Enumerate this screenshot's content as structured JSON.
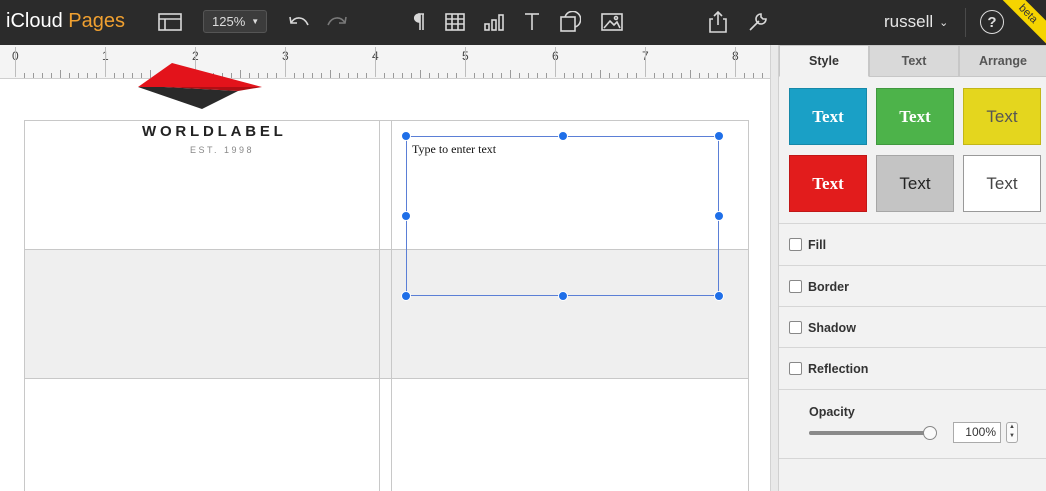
{
  "app": {
    "brand_prefix": "iCloud",
    "brand_app": "Pages"
  },
  "toolbar": {
    "zoom_value": "125%",
    "user_name": "russell",
    "help_glyph": "?",
    "beta_label": "beta",
    "icons": [
      "sidebar-view-icon",
      "undo-icon",
      "redo-icon",
      "paragraph-icon",
      "table-icon",
      "chart-icon",
      "text-icon",
      "shape-icon",
      "media-icon",
      "share-icon",
      "wrench-icon"
    ]
  },
  "ruler": {
    "labels": [
      "0",
      "1",
      "2",
      "3",
      "4",
      "5",
      "6",
      "7",
      "8"
    ]
  },
  "document": {
    "logo_word": "WORLDLABEL",
    "logo_est": "EST. 1998",
    "textbox_text": "Type to enter text"
  },
  "panel": {
    "tabs": [
      "Style",
      "Text",
      "Arrange"
    ],
    "active_tab": "Style",
    "styles": [
      {
        "label": "Text",
        "bg": "#1aa0c6",
        "fg": "#ffffff",
        "font": "serif"
      },
      {
        "label": "Text",
        "bg": "#4db34a",
        "fg": "#ffffff",
        "font": "serif"
      },
      {
        "label": "Text",
        "bg": "#e4d61e",
        "fg": "#555555",
        "font": "sans"
      },
      {
        "label": "Text",
        "bg": "#e21c1c",
        "fg": "#ffffff",
        "font": "serif"
      },
      {
        "label": "Text",
        "bg": "#c4c4c4",
        "fg": "#222222",
        "font": "sans"
      },
      {
        "label": "Text",
        "bg": "#ffffff",
        "fg": "#444444",
        "font": "sans"
      }
    ],
    "options": [
      "Fill",
      "Border",
      "Shadow",
      "Reflection"
    ],
    "opacity": {
      "label": "Opacity",
      "value": "100%",
      "level": 1.0
    }
  },
  "colors": {
    "toolbar_bg": "#2b2b2b",
    "brand_accent": "#f0a030",
    "selection": "#1f6fe8",
    "beta": "#f5d400"
  }
}
